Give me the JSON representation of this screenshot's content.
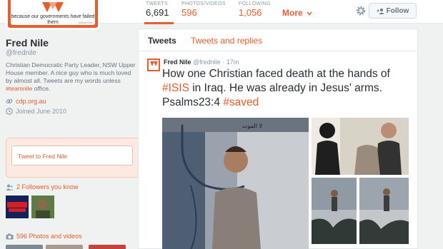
{
  "stats": {
    "tweets": {
      "label": "TWEETS",
      "value": "6,691"
    },
    "photos": {
      "label": "PHOTOS/VIDEOS",
      "value": "596"
    },
    "following": {
      "label": "FOLLOWING",
      "value": "1,056"
    },
    "more": "More"
  },
  "actions": {
    "follow": "Follow",
    "settings_icon": "gear-icon"
  },
  "avatar": {
    "motto": "because our governments have failed them",
    "tag": "@teamnile"
  },
  "profile": {
    "name": "Fred Nile",
    "handle": "@frednile",
    "bio_pre": "Christian Democratic Party Leader, NSW Upper House member. A nice guy who is much loved by almost all. Tweets are my words unless ",
    "bio_tag": "#teamnile",
    "bio_post": " office.",
    "website": "cdp.org.au",
    "joined": "Joined June 2010"
  },
  "compose": {
    "placeholder": "Tweet to Fred Nile"
  },
  "followers": {
    "label": "2 Followers you know"
  },
  "photos_section": {
    "label": "596 Photos and videos"
  },
  "tabs": [
    {
      "label": "Tweets"
    },
    {
      "label": "Tweets and replies"
    }
  ],
  "tweet": {
    "name": "Fred Nile",
    "handle": "@frednile",
    "time": "· 17m",
    "text_1": "How one Christian faced death at the hands of ",
    "hashtag_1": "#ISIS",
    "text_2": " in Iraq. He was already in Jesus' arms. Psalms23:4 ",
    "hashtag_2": "#saved"
  },
  "media": {
    "arabic_caption": "لا الموت"
  },
  "colors": {
    "accent": "#e95c2b",
    "text": "#292f33",
    "muted": "#8899a6",
    "background": "#f0f1f1"
  }
}
